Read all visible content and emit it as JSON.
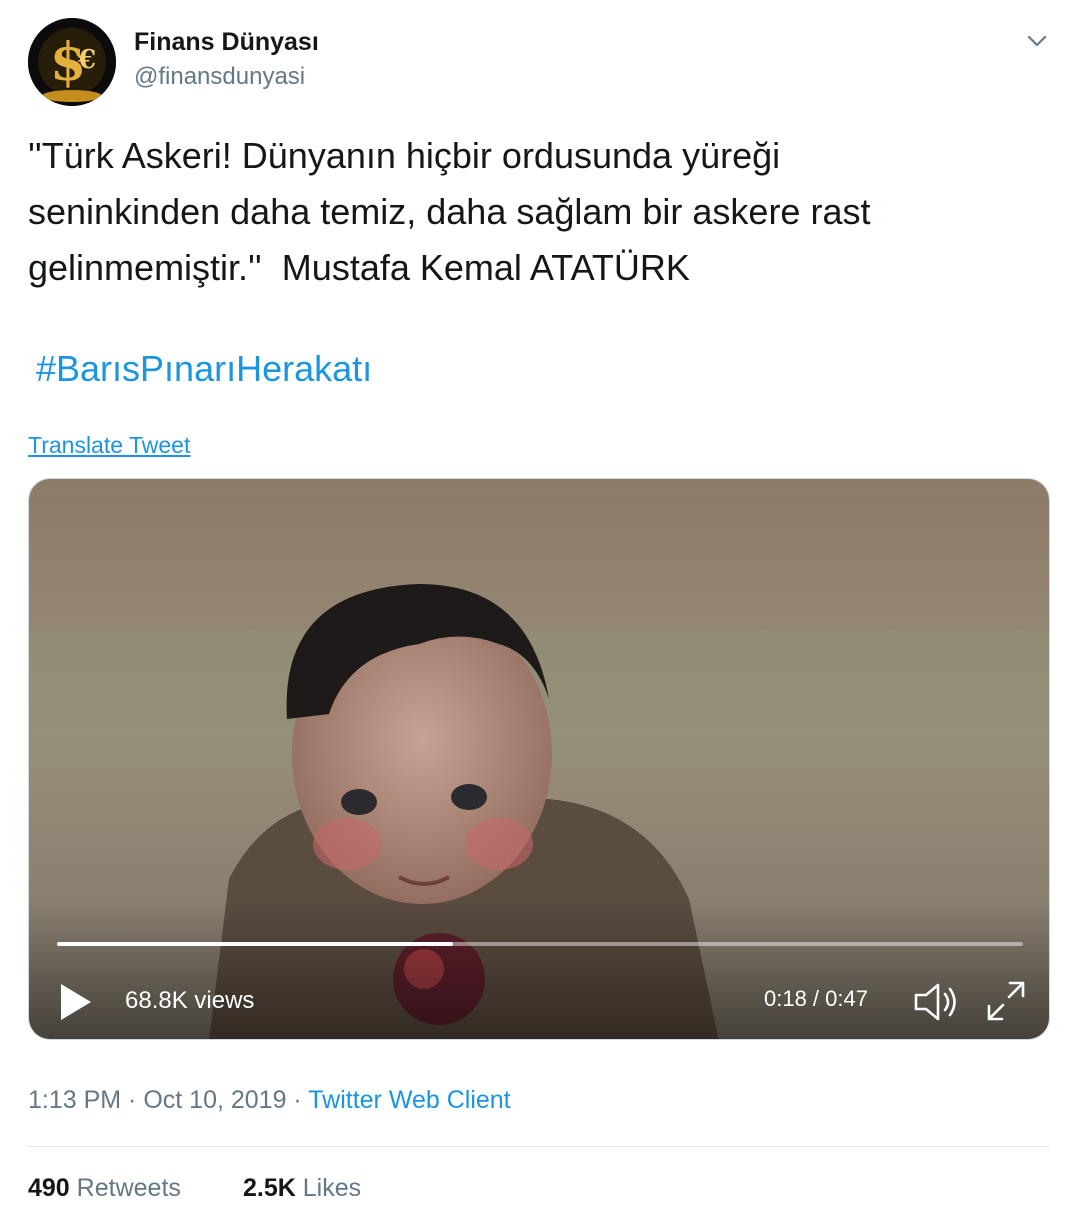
{
  "author": {
    "name": "Finans Dünyası",
    "handle": "@finansdunyasi"
  },
  "tweet": {
    "lines": [
      "''Türk Askeri! Dünyanın hiçbir ordusunda yüreği",
      "seninkinden daha temiz, daha sağlam bir askere rast",
      "gelinmemiştir.''  Mustafa Kemal ATATÜRK"
    ],
    "hashtag": "#BarısPınarıHerakatı",
    "translate_label": "Translate Tweet"
  },
  "video": {
    "views": "68.8K views",
    "time": "0:18 / 0:47",
    "progress_fraction": 0.41
  },
  "meta": {
    "time": "1:13 PM",
    "date": "Oct 10, 2019",
    "separator": " · ",
    "client": "Twitter Web Client"
  },
  "stats": {
    "retweets_count": "490",
    "retweets_label": "Retweets",
    "likes_count": "2.5K",
    "likes_label": "Likes"
  },
  "colors": {
    "link": "#1b95e0",
    "secondary_text": "#657786",
    "primary_text": "#14171a"
  },
  "icons": {
    "caret": "chevron-down-icon",
    "play": "play-icon",
    "volume": "volume-icon",
    "fullscreen": "fullscreen-icon"
  }
}
